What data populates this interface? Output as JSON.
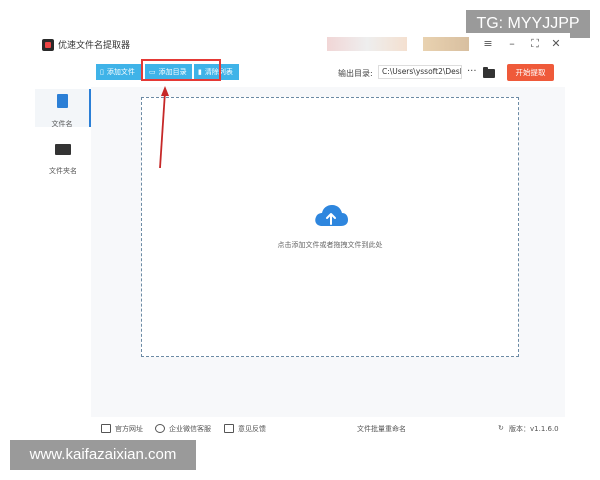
{
  "watermarks": {
    "top_right": "TG: MYYJJPP",
    "bottom_left": "www.kaifazaixian.com"
  },
  "app": {
    "title": "优速文件名提取器"
  },
  "window_controls": {
    "menu": "≡",
    "minimize": "–",
    "maximize": "⛶",
    "close": "✕"
  },
  "toolbar": {
    "add_file": "添加文件",
    "add_dir": "添加目录",
    "clear_list": "清除列表",
    "output_label": "输出目录:",
    "output_path": "C:\\Users\\yssoft2\\Deskt",
    "more": "···",
    "start": "开始提取"
  },
  "sidebar": {
    "items": [
      {
        "label": "文件名",
        "icon": "file-icon",
        "active": true
      },
      {
        "label": "文件夹名",
        "icon": "folder-icon",
        "active": false
      }
    ]
  },
  "dropzone": {
    "hint": "点击添加文件或者拖拽文件到此处",
    "icon": "cloud-upload-icon"
  },
  "statusbar": {
    "website": "官方网址",
    "wechat": "企业微信客服",
    "feedback": "意见反馈",
    "center": "文件批量重命名",
    "version": "版本：v1.1.6.0"
  },
  "colors": {
    "accent": "#3fb3e8",
    "start": "#ef5a3a",
    "highlight": "#e53935",
    "sidebar_active": "#2b7fd6"
  }
}
